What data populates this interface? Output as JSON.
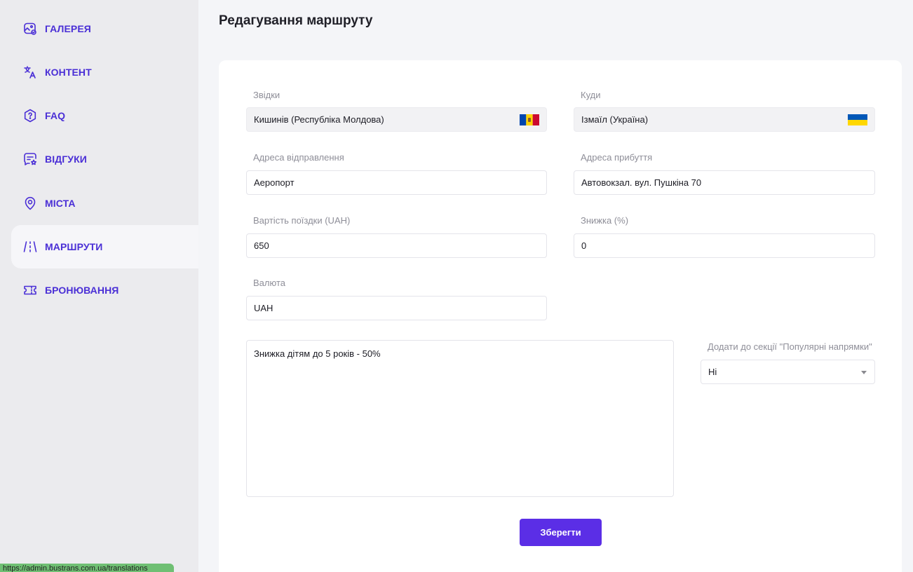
{
  "sidebar": {
    "items": [
      {
        "label": "ГАЛЕРЕЯ",
        "icon": "gallery-icon"
      },
      {
        "label": "КОНТЕНТ",
        "icon": "translate-icon"
      },
      {
        "label": "FAQ",
        "icon": "question-icon"
      },
      {
        "label": "ВІДГУКИ",
        "icon": "reviews-icon"
      },
      {
        "label": "МІСТА",
        "icon": "location-pin-icon"
      },
      {
        "label": "МАРШРУТИ",
        "icon": "route-icon",
        "active": true
      },
      {
        "label": "БРОНЮВАННЯ",
        "icon": "ticket-icon"
      }
    ],
    "accent_color": "#4a2fd6"
  },
  "status_bar": {
    "url": "https://admin.bustrans.com.ua/translations"
  },
  "page": {
    "title": "Редагування маршруту"
  },
  "form": {
    "from": {
      "label": "Звідки",
      "value": "Кишинів (Республіка Молдова)",
      "flag": "moldova-flag-icon"
    },
    "to": {
      "label": "Куди",
      "value": "Ізмаїл (Україна)",
      "flag": "ukraine-flag-icon"
    },
    "departure_address": {
      "label": "Адреса відправлення",
      "value": "Аеропорт"
    },
    "arrival_address": {
      "label": "Адреса прибуття",
      "value": "Автовокзал. вул. Пушкіна 70"
    },
    "price": {
      "label": "Вартість поїздки (UAH)",
      "value": "650"
    },
    "discount": {
      "label": "Знижка (%)",
      "value": "0"
    },
    "currency": {
      "label": "Валюта",
      "value": "UAH"
    },
    "note": {
      "value": "Знижка дітям до 5 років - 50%"
    },
    "popular": {
      "label": "Додати до секції \"Популярні напрямки\"",
      "value": "Ні"
    },
    "save_label": "Зберегти"
  },
  "colors": {
    "button": "#5b2ee6",
    "background": "#f4f5f8",
    "sidebar": "#ebebee"
  }
}
